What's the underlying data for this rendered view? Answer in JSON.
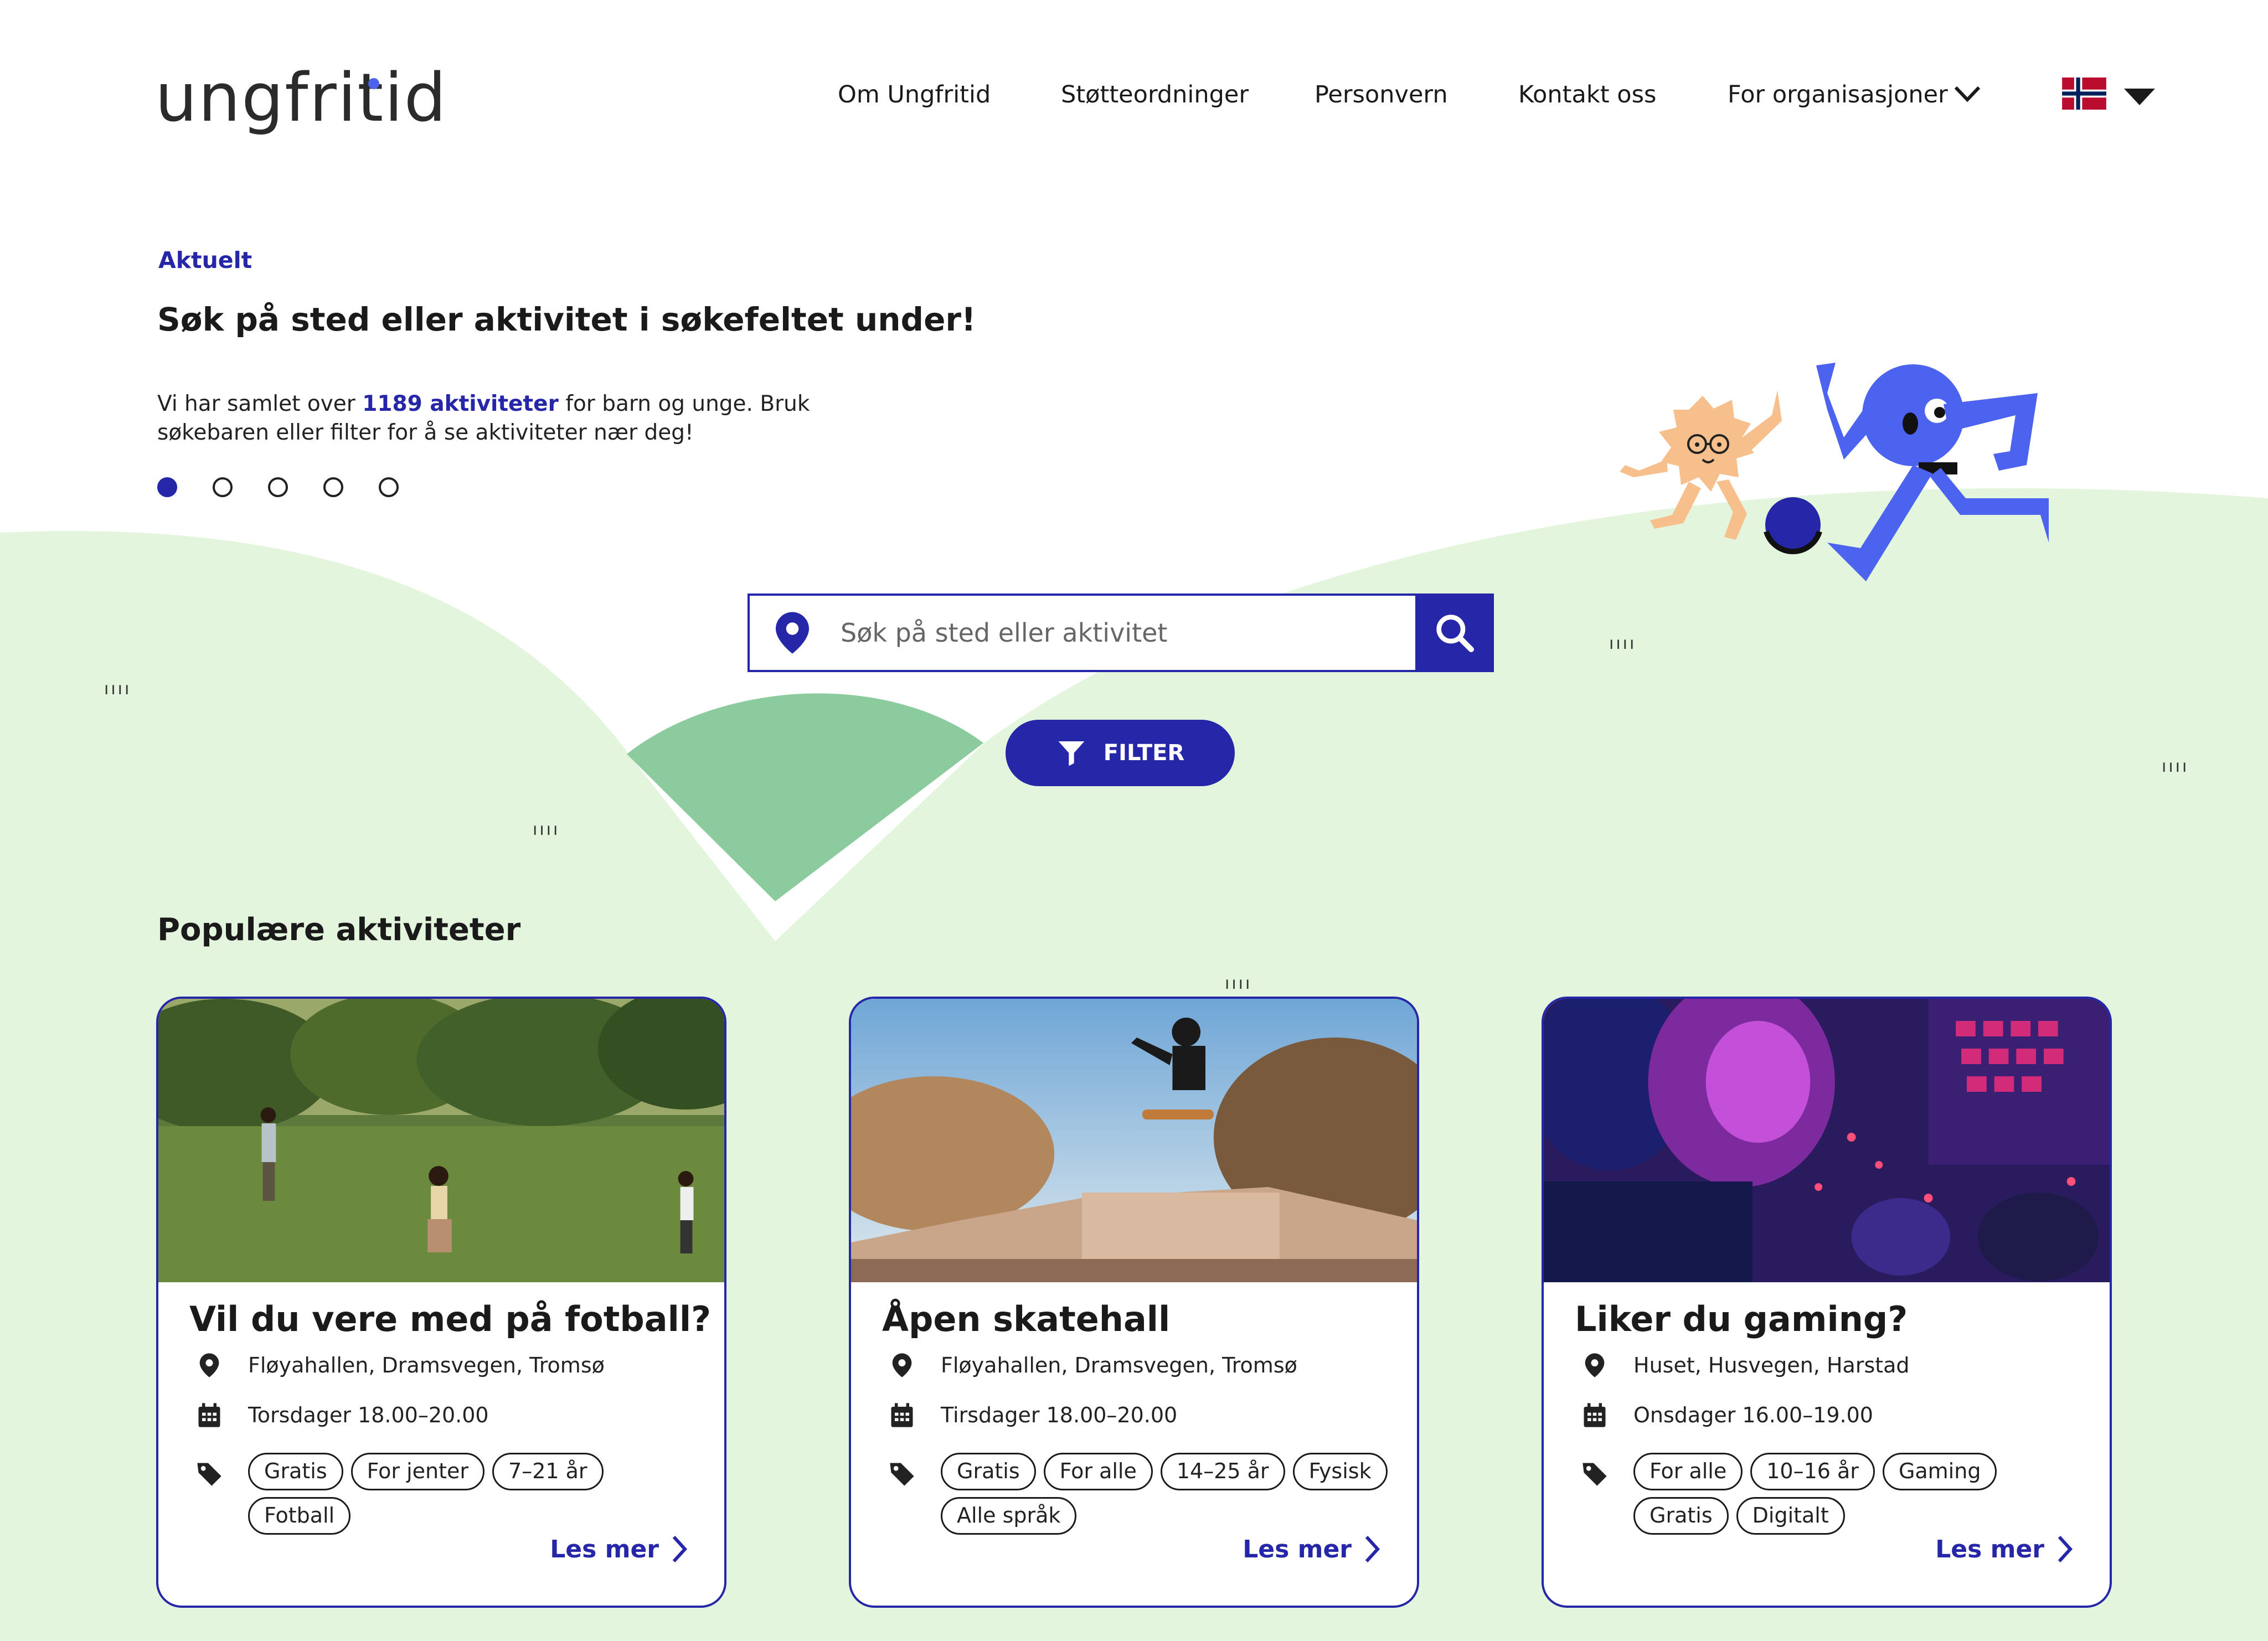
{
  "header": {
    "logo": "ungfritid",
    "nav": [
      {
        "label": "Om Ungfritid"
      },
      {
        "label": "Støtteordninger"
      },
      {
        "label": "Personvern"
      },
      {
        "label": "Kontakt oss"
      },
      {
        "label": "For organisasjoner"
      }
    ],
    "language_flag": "norway-flag-icon"
  },
  "hero": {
    "eyebrow": "Aktuelt",
    "title": "Søk på sted eller aktivitet i søkefeltet under!",
    "text_before": "Vi har samlet over ",
    "text_highlight": "1189 aktiviteter",
    "text_after": " for barn og unge. Bruk søkebaren eller filter for å se aktiviteter nær deg!",
    "carousel_total": 5,
    "carousel_active": 1
  },
  "search": {
    "placeholder": "Søk på sted eller aktivitet",
    "filter_label": "FILTER"
  },
  "popular": {
    "title": "Populære aktiviteter",
    "cards": [
      {
        "title": "Vil du vere med på fotball?",
        "location": "Fløyahallen, Dramsvegen, Tromsø",
        "time": "Torsdager 18.00–20.00",
        "tags": [
          "Gratis",
          "For jenter",
          "7–21 år",
          "Fotball"
        ],
        "more": "Les mer",
        "image": "football-in-park"
      },
      {
        "title": "Åpen skatehall",
        "location": "Fløyahallen, Dramsvegen, Tromsø",
        "time": "Tirsdager 18.00–20.00",
        "tags": [
          "Gratis",
          "For alle",
          "14–25 år",
          "Fysisk",
          "Alle språk"
        ],
        "more": "Les mer",
        "image": "skateboarder-jump"
      },
      {
        "title": "Liker du gaming?",
        "location": "Huset, Husvegen, Harstad",
        "time": "Onsdager 16.00–19.00",
        "tags": [
          "For alle",
          "10–16 år",
          "Gaming",
          "Gratis",
          "Digitalt"
        ],
        "more": "Les mer",
        "image": "gaming-headset-keyboard"
      }
    ]
  },
  "colors": {
    "brand": "#2626a8",
    "light_green": "#e3f5dc",
    "mid_green": "#8ccb9e",
    "mascot_blue": "#4b63ee",
    "mascot_orange": "#f7bf8c"
  }
}
